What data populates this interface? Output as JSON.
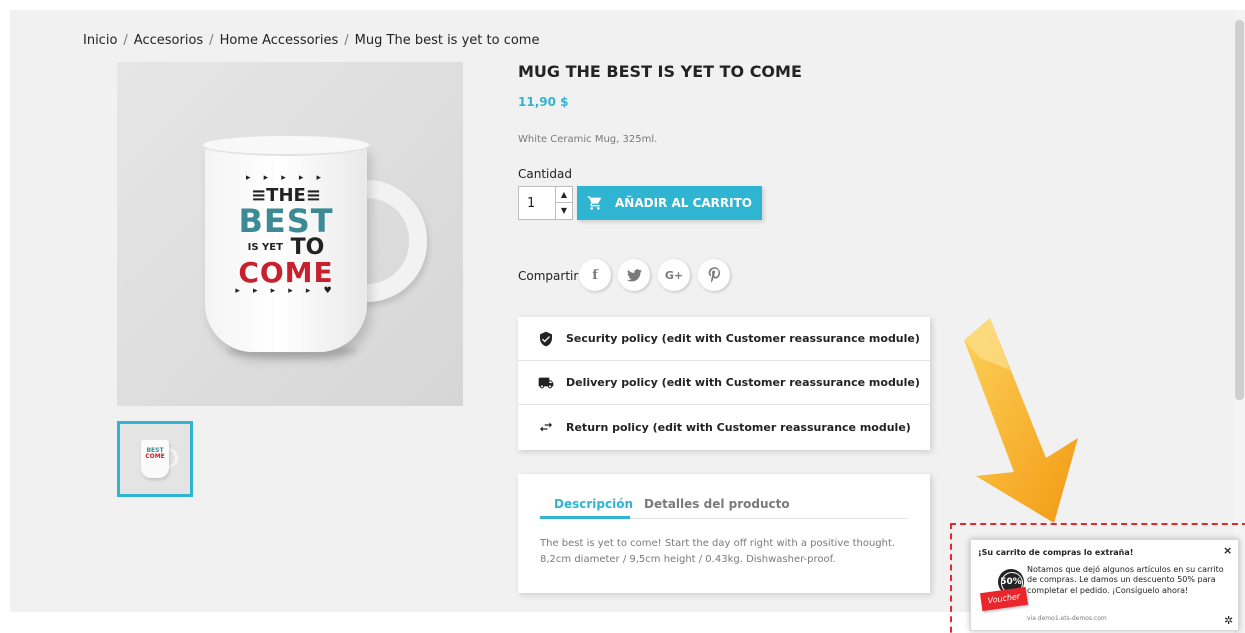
{
  "breadcrumb": {
    "items": [
      "Inicio",
      "Accesorios",
      "Home Accessories",
      "Mug The best is yet to come"
    ],
    "separator": "/"
  },
  "product": {
    "title": "MUG THE BEST IS YET TO COME",
    "price": "11,90 $",
    "short_description": "White Ceramic Mug, 325ml.",
    "mug_art": {
      "line1": "▸ ▸ ▸ ▸ ▸",
      "line2": "≡THE≡",
      "line3": "BEST",
      "line4_small": "IS YET",
      "line4_big": "TO",
      "line5": "COME",
      "line6": "▸ ▸ ▸ ▸ ▸ ♥"
    }
  },
  "quantity": {
    "label": "Cantidad",
    "value": "1",
    "up_icon": "▲",
    "down_icon": "▼"
  },
  "add_to_cart": {
    "label": "AÑADIR AL CARRITO",
    "icon": "shopping-cart-icon"
  },
  "share": {
    "label": "Compartir",
    "buttons": [
      {
        "name": "facebook",
        "glyph": "f"
      },
      {
        "name": "twitter",
        "glyph": "t"
      },
      {
        "name": "google-plus",
        "glyph": "G+"
      },
      {
        "name": "pinterest",
        "glyph": "P"
      }
    ]
  },
  "reassurance": [
    {
      "label": "Security policy (edit with Customer reassurance module)",
      "icon": "shield-icon"
    },
    {
      "label": "Delivery policy (edit with Customer reassurance module)",
      "icon": "truck-icon"
    },
    {
      "label": "Return policy (edit with Customer reassurance module)",
      "icon": "exchange-arrows-icon"
    }
  ],
  "tabs": {
    "items": [
      "Descripción",
      "Detalles del producto"
    ],
    "active": "Descripción",
    "content": "The best is yet to come! Start the day off right with a positive thought. 8,2cm diameter / 9,5cm height / 0.43kg. Dishwasher-proof."
  },
  "popup": {
    "title": "¡Su carrito de compras lo extraña!",
    "close": "×",
    "message": "Notamos que dejó algunos artículos en su carrito de compras. Le damos un descuento 50% para completar el pedido. ¡Consíguelo ahora!",
    "via": "via demo1.ets-demos.com",
    "gear": "✲",
    "voucher_percent": "50%",
    "voucher_label": "Voucher"
  },
  "colors": {
    "accent": "#2fb5d2",
    "highlight_border": "#e8262b",
    "arrow": "#f5a623",
    "page_bg": "#f1f1f1"
  }
}
